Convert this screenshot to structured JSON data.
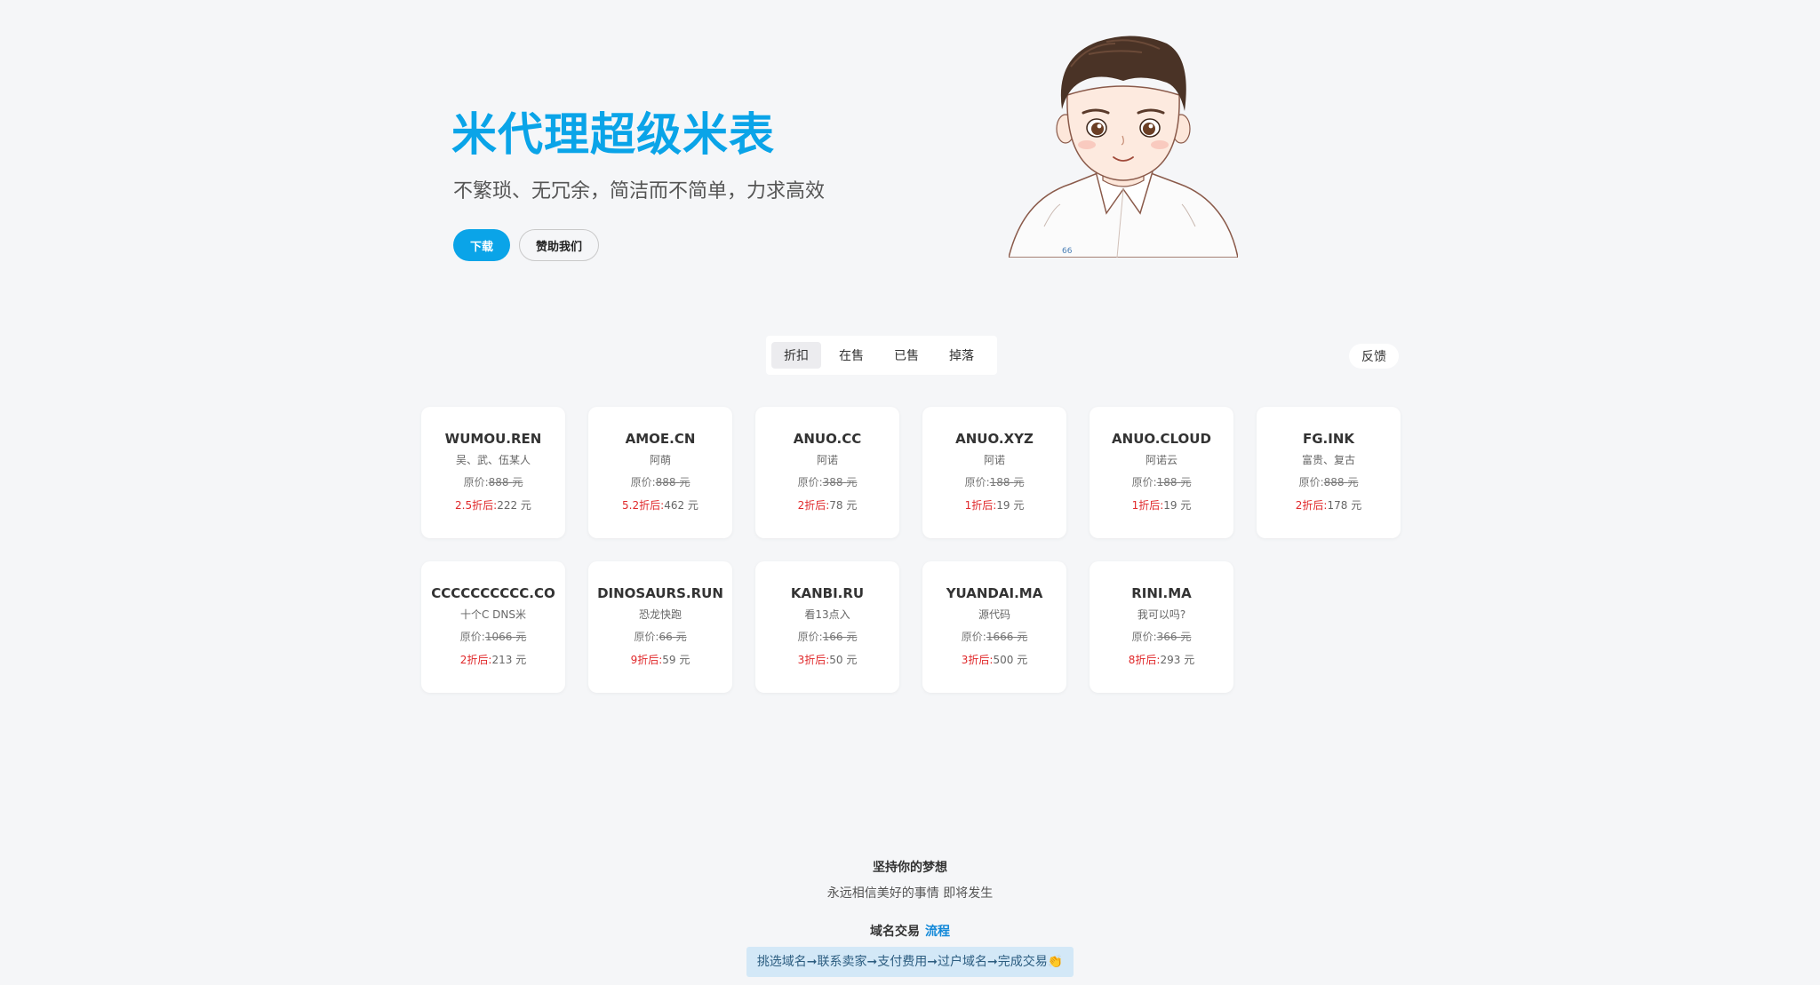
{
  "hero": {
    "title": "米代理超级米表",
    "subtitle": "不繁琐、无冗余，简洁而不简单，力求高效",
    "download_label": "下载",
    "sponsor_label": "赞助我们"
  },
  "tabs": [
    {
      "label": "折扣",
      "active": true
    },
    {
      "label": "在售",
      "active": false
    },
    {
      "label": "已售",
      "active": false
    },
    {
      "label": "掉落",
      "active": false
    }
  ],
  "feedback_label": "反馈",
  "price_labels": {
    "original_prefix": "原价:",
    "unit": "元"
  },
  "domains": [
    {
      "domain": "WUMOU.REN",
      "meaning": "吴、武、伍某人",
      "original": "888",
      "discount": "2.5折后:",
      "price": "222"
    },
    {
      "domain": "AMOE.CN",
      "meaning": "阿萌",
      "original": "888",
      "discount": "5.2折后:",
      "price": "462"
    },
    {
      "domain": "ANUO.CC",
      "meaning": "阿诺",
      "original": "388",
      "discount": "2折后:",
      "price": "78"
    },
    {
      "domain": "ANUO.XYZ",
      "meaning": "阿诺",
      "original": "188",
      "discount": "1折后:",
      "price": "19"
    },
    {
      "domain": "ANUO.CLOUD",
      "meaning": "阿诺云",
      "original": "188",
      "discount": "1折后:",
      "price": "19"
    },
    {
      "domain": "FG.INK",
      "meaning": "富贵、复古",
      "original": "888",
      "discount": "2折后:",
      "price": "178"
    },
    {
      "domain": "CCCCCCCCCC.CO",
      "meaning": "十个C DNS米",
      "original": "1066",
      "discount": "2折后:",
      "price": "213"
    },
    {
      "domain": "DINOSAURS.RUN",
      "meaning": "恐龙快跑",
      "original": "66",
      "discount": "9折后:",
      "price": "59"
    },
    {
      "domain": "KANBI.RU",
      "meaning": "看13点入",
      "original": "166",
      "discount": "3折后:",
      "price": "50"
    },
    {
      "domain": "YUANDAI.MA",
      "meaning": "源代码",
      "original": "1666",
      "discount": "3折后:",
      "price": "500"
    },
    {
      "domain": "RINI.MA",
      "meaning": "我可以吗?",
      "original": "366",
      "discount": "8折后:",
      "price": "293"
    }
  ],
  "footer": {
    "motto_title": "坚持你的梦想",
    "motto_sub": "永远相信美好的事情 即将发生",
    "trade_title": "域名交易",
    "trade_link": "流程",
    "flow": "挑选域名➞联系卖家➞支付费用➞过户域名➞完成交易👏"
  },
  "colors": {
    "accent": "#0aa4e8",
    "discount_red": "#e0292b",
    "background": "#f5f6f8"
  }
}
